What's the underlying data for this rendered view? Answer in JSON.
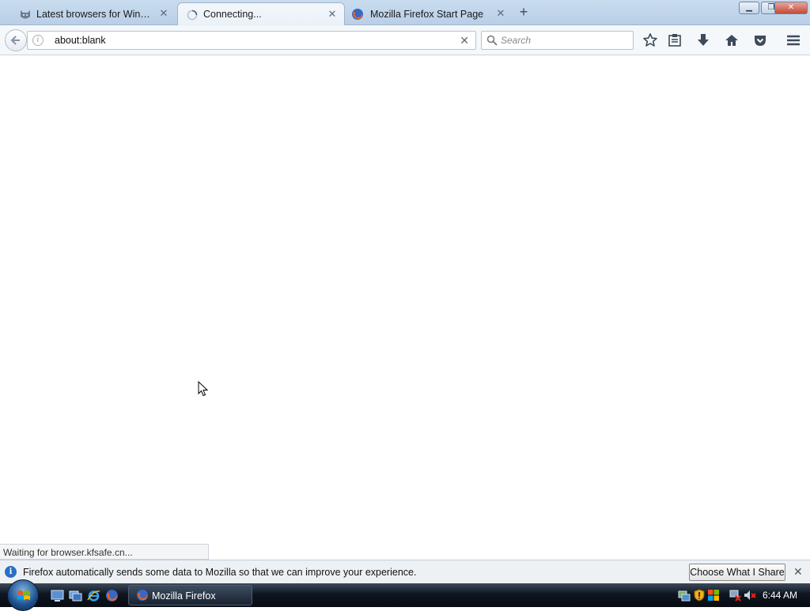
{
  "tabs": [
    {
      "label": "Latest browsers for Windo...",
      "icon": "cat-favicon-icon",
      "state": "inactive"
    },
    {
      "label": "Connecting...",
      "icon": "loading-spinner-icon",
      "state": "active"
    },
    {
      "label": "Mozilla Firefox Start Page",
      "icon": "firefox-icon",
      "state": "inactive"
    }
  ],
  "window_controls": {
    "minimize": "minimize",
    "maximize": "restore",
    "close": "close"
  },
  "navbar": {
    "url": "about:blank",
    "search_placeholder": "Search"
  },
  "status_text": "Waiting for browser.kfsafe.cn...",
  "notification": {
    "text": "Firefox automatically sends some data to Mozilla so that we can improve your experience.",
    "button": "Choose What I Share"
  },
  "taskbar": {
    "task_label": "Mozilla Firefox",
    "clock": "6:44 AM"
  },
  "colors": {
    "tab_bar": "#c9dcef",
    "accent": "#2a6fc4",
    "taskbar": "#0f1620"
  }
}
